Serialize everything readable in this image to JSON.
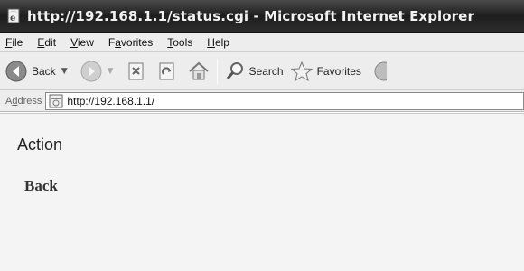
{
  "window": {
    "title": "http://192.168.1.1/status.cgi - Microsoft Internet Explorer",
    "icon": "ie-page-icon"
  },
  "menu": [
    {
      "label": "File",
      "access_key": "F"
    },
    {
      "label": "Edit",
      "access_key": "E"
    },
    {
      "label": "View",
      "access_key": "V"
    },
    {
      "label": "Favorites",
      "access_key": "a"
    },
    {
      "label": "Tools",
      "access_key": "T"
    },
    {
      "label": "Help",
      "access_key": "H"
    }
  ],
  "toolbar": {
    "back_label": "Back",
    "search_label": "Search",
    "favorites_label": "Favorites"
  },
  "address": {
    "label": "Address",
    "url": "http://192.168.1.1/"
  },
  "content": {
    "heading": "Action",
    "link": "Back"
  }
}
